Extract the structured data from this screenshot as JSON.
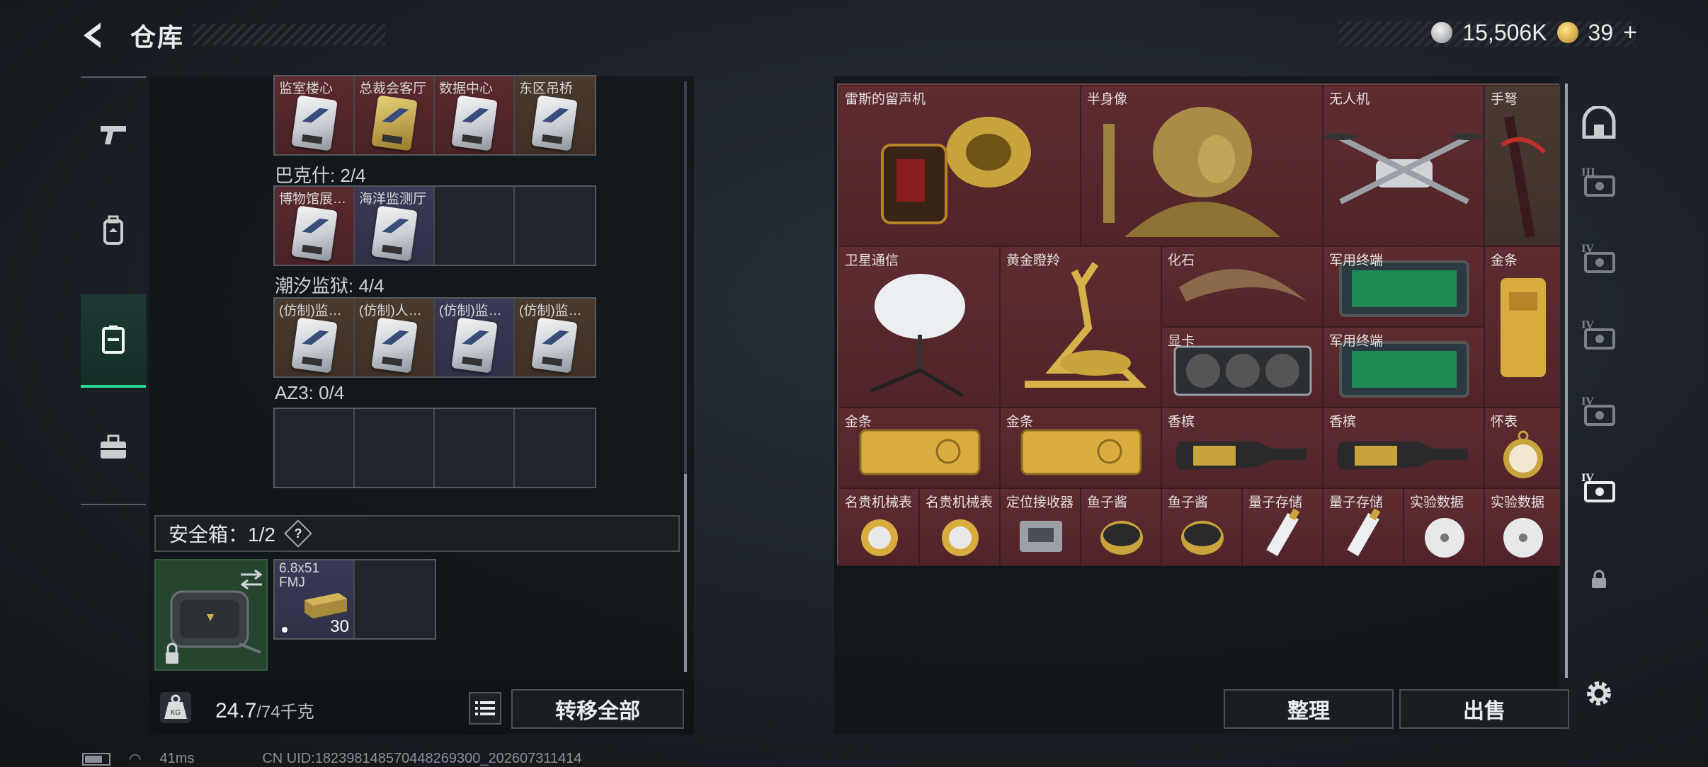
{
  "header": {
    "title": "仓库",
    "currency_silver": "15,506K",
    "currency_gold": "39",
    "currency_plus": "+"
  },
  "left_tabs": [
    {
      "icon": "pistol-icon"
    },
    {
      "icon": "backpack-icon"
    },
    {
      "icon": "container-icon",
      "active": true
    },
    {
      "icon": "toolbox-icon"
    }
  ],
  "key_groups": [
    {
      "name": "",
      "slots": [
        {
          "label": "监室楼心",
          "color": "red"
        },
        {
          "label": "总裁会客厅",
          "color": "red",
          "card": "gold"
        },
        {
          "label": "数据中心",
          "color": "red"
        },
        {
          "label": "东区吊桥",
          "color": "brown"
        }
      ]
    },
    {
      "name": "巴克什: 2/4",
      "slots": [
        {
          "label": "博物馆展…",
          "color": "red"
        },
        {
          "label": "海洋监测厅",
          "color": "blue"
        },
        {
          "label": "",
          "color": "empty"
        },
        {
          "label": "",
          "color": "empty"
        }
      ]
    },
    {
      "name": "潮汐监狱: 4/4",
      "slots": [
        {
          "label": "(仿制)监…",
          "color": "brown"
        },
        {
          "label": "(仿制)人…",
          "color": "brown"
        },
        {
          "label": "(仿制)监…",
          "color": "blue"
        },
        {
          "label": "(仿制)监…",
          "color": "brown"
        }
      ]
    },
    {
      "name": "AZ3: 0/4",
      "slots": [
        {
          "label": "",
          "color": "empty"
        },
        {
          "label": "",
          "color": "empty"
        },
        {
          "label": "",
          "color": "empty"
        },
        {
          "label": "",
          "color": "empty"
        }
      ]
    }
  ],
  "safe_box": {
    "label": "安全箱：1/2",
    "help": "?",
    "ammo_label": "6.8x51 FMJ",
    "ammo_count": "30"
  },
  "footer_left": {
    "weight_value": "24.7",
    "weight_max": "/74千克",
    "transfer_all": "转移全部"
  },
  "stash_items": [
    {
      "label": "雷斯的留声机",
      "kind": "gramophone"
    },
    {
      "label": "半身像",
      "kind": "bust"
    },
    {
      "label": "无人机",
      "kind": "drone"
    },
    {
      "label": "手弩",
      "kind": "crossbow"
    },
    {
      "label": "卫星通信",
      "kind": "satellite"
    },
    {
      "label": "黄金瞪羚",
      "kind": "gazelle"
    },
    {
      "label": "化石",
      "kind": "fossil"
    },
    {
      "label": "军用终端",
      "kind": "terminal"
    },
    {
      "label": "金条",
      "kind": "goldbar-v"
    },
    {
      "label": "显卡",
      "kind": "gpu"
    },
    {
      "label": "军用终端",
      "kind": "terminal"
    },
    {
      "label": "金条",
      "kind": "goldbar"
    },
    {
      "label": "金条",
      "kind": "goldbar"
    },
    {
      "label": "香槟",
      "kind": "champagne"
    },
    {
      "label": "香槟",
      "kind": "champagne"
    },
    {
      "label": "怀表",
      "kind": "pocketwatch"
    },
    {
      "label": "名贵机械表",
      "kind": "watch"
    },
    {
      "label": "名贵机械表",
      "kind": "watch"
    },
    {
      "label": "定位接收器",
      "kind": "receiver"
    },
    {
      "label": "鱼子酱",
      "kind": "caviar"
    },
    {
      "label": "鱼子酱",
      "kind": "caviar"
    },
    {
      "label": "量子存储",
      "kind": "usb"
    },
    {
      "label": "量子存储",
      "kind": "usb"
    },
    {
      "label": "实验数据",
      "kind": "disc"
    },
    {
      "label": "实验数据",
      "kind": "disc"
    }
  ],
  "right_buttons": {
    "sort": "整理",
    "sell": "出售"
  },
  "right_tabs": [
    {
      "icon": "stash-home-icon",
      "tier": ""
    },
    {
      "icon": "stash-tier3-icon",
      "tier": "III"
    },
    {
      "icon": "stash-tier4-folder-icon",
      "tier": "IV"
    },
    {
      "icon": "stash-tier4-medical-icon",
      "tier": "IV"
    },
    {
      "icon": "stash-tier4-ammo-icon",
      "tier": "IV"
    },
    {
      "icon": "stash-tier4-valuables-icon",
      "tier": "IV"
    },
    {
      "icon": "lock-icon",
      "tier": ""
    }
  ],
  "status": {
    "ping": "41ms",
    "uid": "CN UID:18239814857044826930​0_202607311414"
  }
}
